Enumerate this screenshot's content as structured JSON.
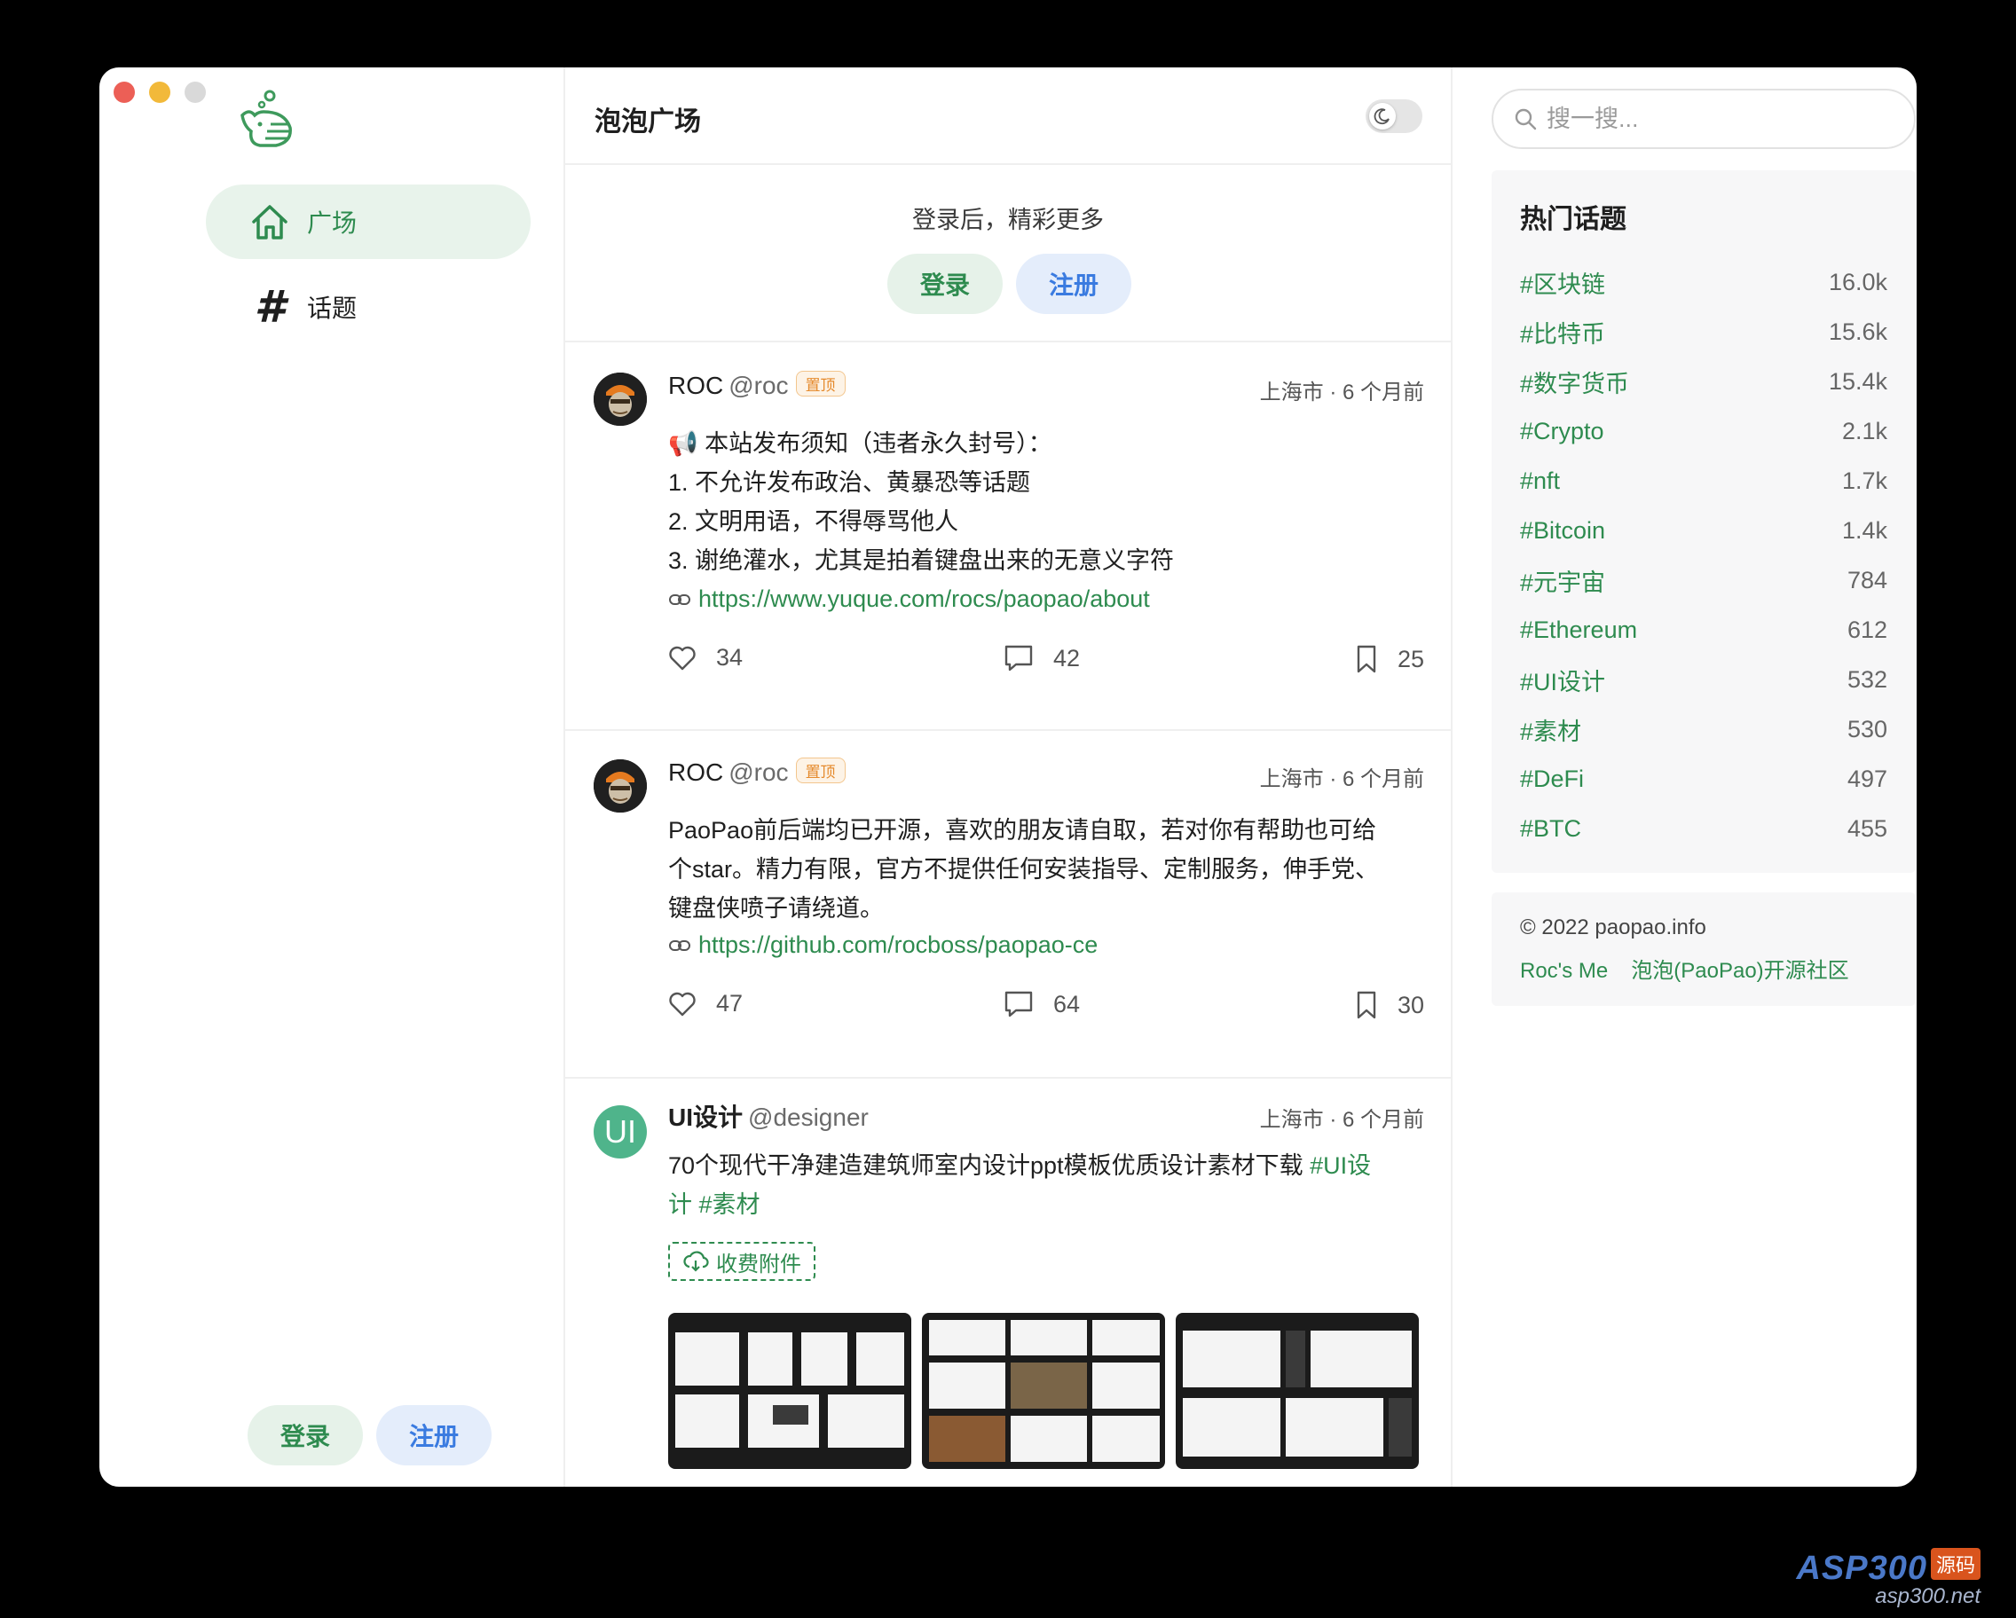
{
  "sidebar": {
    "nav": [
      {
        "label": "广场",
        "icon": "home-icon",
        "active": true
      },
      {
        "label": "话题",
        "icon": "hash-icon",
        "active": false
      }
    ],
    "login_label": "登录",
    "register_label": "注册"
  },
  "header": {
    "title": "泡泡广场",
    "theme_toggle_icon": "moon-icon"
  },
  "login_prompt": {
    "text": "登录后，精彩更多",
    "login_label": "登录",
    "register_label": "注册"
  },
  "posts": [
    {
      "author": "ROC",
      "handle": "@roc",
      "badge": "置顶",
      "meta": "上海市 · 6 个月前",
      "lines": [
        "📢 本站发布须知（违者永久封号）：",
        "1. 不允许发布政治、黄暴恐等话题",
        "2. 文明用语，不得辱骂他人",
        "3. 谢绝灌水，尤其是拍着键盘出来的无意义字符"
      ],
      "link": "https://www.yuque.com/rocs/paopao/about",
      "likes": "34",
      "comments": "42",
      "bookmarks": "25"
    },
    {
      "author": "ROC",
      "handle": "@roc",
      "badge": "置顶",
      "meta": "上海市 · 6 个月前",
      "lines": [
        "PaoPao前后端均已开源，喜欢的朋友请自取，若对你有帮助也可给",
        "个star。精力有限，官方不提供任何安装指导、定制服务，伸手党、",
        "键盘侠喷子请绕道。"
      ],
      "link": "https://github.com/rocboss/paopao-ce",
      "likes": "47",
      "comments": "64",
      "bookmarks": "30"
    },
    {
      "author": "UI设计",
      "handle": "@designer",
      "avatar_text": "UI",
      "meta": "上海市 · 6 个月前",
      "text_a": "70个现代干净建造建筑师室内设计ppt模板优质设计素材下载 ",
      "tag_a": "#UI设",
      "tag_a2": "计",
      "tag_b": "#素材",
      "attachment": "收费附件"
    }
  ],
  "search": {
    "placeholder": "搜一搜..."
  },
  "hot_topics": {
    "title": "热门话题",
    "items": [
      {
        "tag": "#区块链",
        "count": "16.0k"
      },
      {
        "tag": "#比特币",
        "count": "15.6k"
      },
      {
        "tag": "#数字货币",
        "count": "15.4k"
      },
      {
        "tag": "#Crypto",
        "count": "2.1k"
      },
      {
        "tag": "#nft",
        "count": "1.7k"
      },
      {
        "tag": "#Bitcoin",
        "count": "1.4k"
      },
      {
        "tag": "#元宇宙",
        "count": "784"
      },
      {
        "tag": "#Ethereum",
        "count": "612"
      },
      {
        "tag": "#UI设计",
        "count": "532"
      },
      {
        "tag": "#素材",
        "count": "530"
      },
      {
        "tag": "#DeFi",
        "count": "497"
      },
      {
        "tag": "#BTC",
        "count": "455"
      }
    ]
  },
  "footer": {
    "copyright": "© 2022 paopao.info",
    "links": [
      "Roc's Me",
      "泡泡(PaoPao)开源社区"
    ]
  },
  "watermark": {
    "brand": "ASP300",
    "badge": "源码",
    "site": "asp300.net"
  },
  "colors": {
    "accent": "#2e8b4f",
    "blue": "#3a7be0"
  }
}
